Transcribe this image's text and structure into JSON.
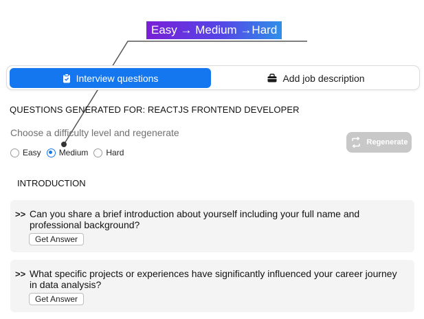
{
  "callout": {
    "text": "Easy → Medium →Hard"
  },
  "tabs": [
    {
      "label": "Interview questions",
      "icon": "clipboard-icon"
    },
    {
      "label": "Add job description",
      "icon": "briefcase-icon"
    }
  ],
  "heading": "QUESTIONS GENERATED FOR: REACTJS FRONTEND DEVELOPER",
  "difficulty": {
    "prompt": "Choose a difficulty level and regenerate",
    "options": [
      "Easy",
      "Medium",
      "Hard"
    ],
    "selected": "Medium"
  },
  "regenerate_label": "Regenerate",
  "section_title": "INTRODUCTION",
  "questions": [
    {
      "marker": ">>",
      "text": "Can you share a brief introduction about yourself including your full name and professional background?",
      "button": "Get Answer"
    },
    {
      "marker": ">>",
      "text": "What specific projects or experiences have significantly influenced your career journey in data analysis?",
      "button": "Get Answer"
    }
  ],
  "colors": {
    "accent": "#1577f0",
    "disabled": "#c8c8c8",
    "card": "#f4f4f4",
    "callout_start": "#7a1fd6",
    "callout_end": "#2f8fe8"
  }
}
